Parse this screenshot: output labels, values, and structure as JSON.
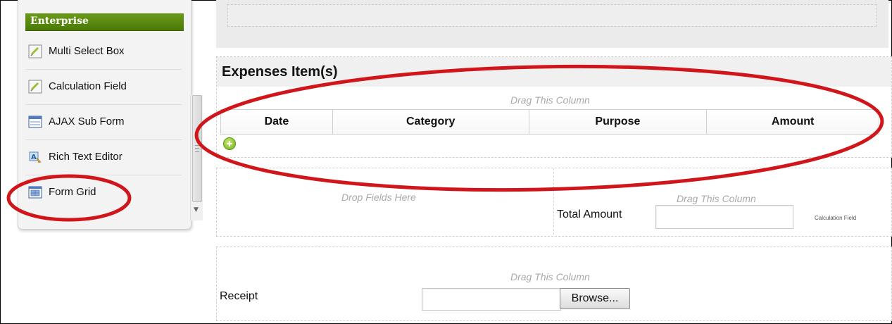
{
  "sidebar": {
    "header": "Enterprise",
    "items": [
      {
        "label": "Multi Select Box",
        "icon": "pencil-doc-icon"
      },
      {
        "label": "Calculation Field",
        "icon": "pencil-doc-icon"
      },
      {
        "label": "AJAX Sub Form",
        "icon": "subform-window-icon"
      },
      {
        "label": "Rich Text Editor",
        "icon": "rich-text-icon"
      },
      {
        "label": "Form Grid",
        "icon": "form-grid-icon"
      }
    ]
  },
  "expenses": {
    "title": "Expenses Item(s)",
    "drag_hint": "Drag This Column",
    "columns": [
      "Date",
      "Category",
      "Purpose",
      "Amount"
    ]
  },
  "totals": {
    "drop_hint": "Drop Fields Here",
    "drag_hint": "Drag This Column",
    "label": "Total Amount",
    "value": "",
    "field_type": "Calculation Field"
  },
  "receipt": {
    "drag_hint": "Drag This Column",
    "label": "Receipt",
    "file_value": "",
    "browse_label": "Browse..."
  },
  "colors": {
    "enterprise_header": "#5a8a0e",
    "annotation": "#d0161b"
  }
}
